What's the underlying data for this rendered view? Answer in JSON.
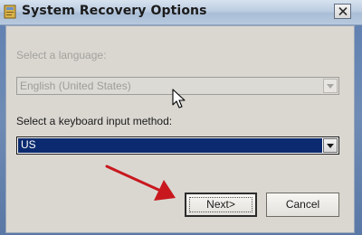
{
  "window": {
    "title": "System Recovery Options"
  },
  "language": {
    "label": "Select a language:",
    "value": "English (United States)",
    "enabled": false
  },
  "keyboard": {
    "label": "Select a keyboard input method:",
    "value": "US",
    "enabled": true
  },
  "buttons": {
    "next_label": "Next>",
    "cancel_label": "Cancel"
  },
  "colors": {
    "selection": "#0b2a6f",
    "annotation_arrow": "#c8181e",
    "dialog_background": "#dad7d1"
  },
  "icons": {
    "title": "system-recovery-icon",
    "close": "close-icon",
    "dropdown": "chevron-down-icon",
    "pointer": "mouse-pointer-icon",
    "annotation": "red-arrow-annotation"
  }
}
